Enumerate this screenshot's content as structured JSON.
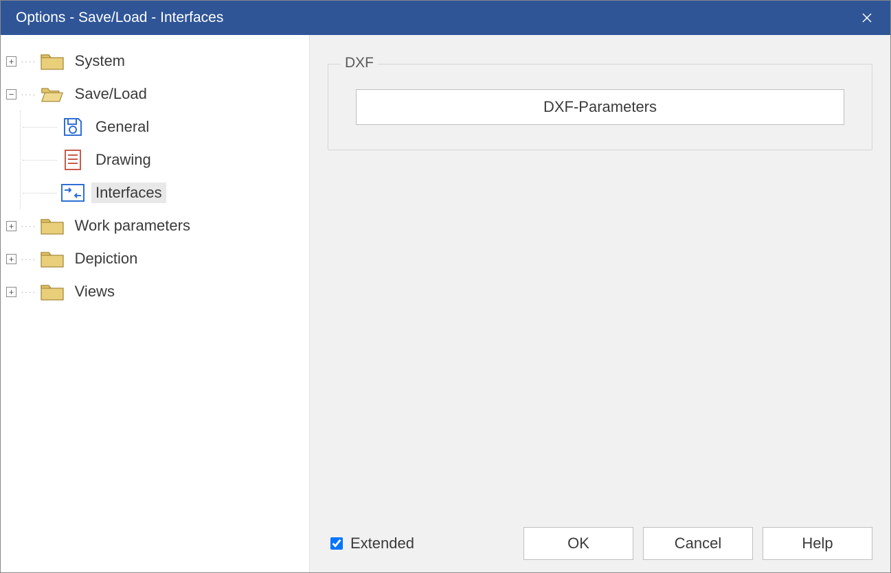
{
  "window": {
    "title": "Options - Save/Load - Interfaces"
  },
  "tree": {
    "system": "System",
    "saveload": "Save/Load",
    "general": "General",
    "drawing": "Drawing",
    "interfaces": "Interfaces",
    "workparams": "Work parameters",
    "depiction": "Depiction",
    "views": "Views"
  },
  "main": {
    "group_legend": "DXF",
    "dxf_button": "DXF-Parameters"
  },
  "footer": {
    "extended": "Extended",
    "ok": "OK",
    "cancel": "Cancel",
    "help": "Help"
  }
}
